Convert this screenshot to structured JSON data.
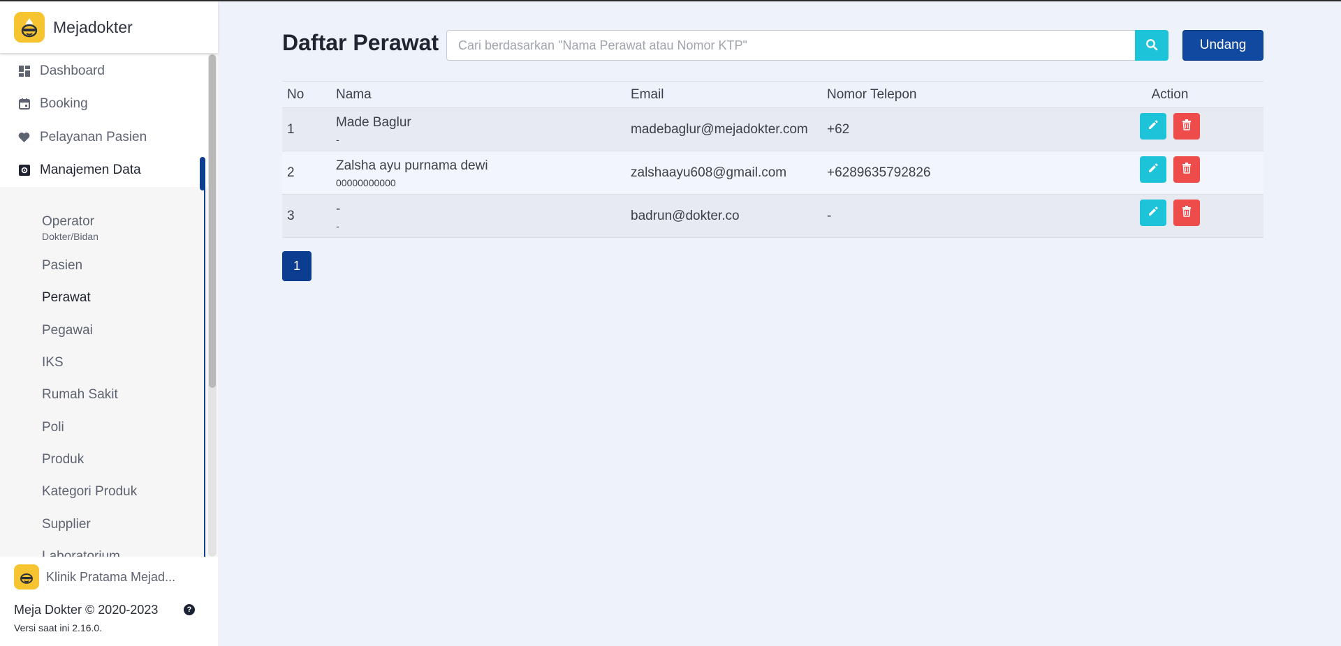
{
  "brand": {
    "name": "Mejadokter"
  },
  "nav": {
    "items": [
      {
        "label": "Dashboard",
        "icon": "dashboard-icon"
      },
      {
        "label": "Booking",
        "icon": "calendar-icon"
      },
      {
        "label": "Pelayanan Pasien",
        "icon": "heart-icon"
      },
      {
        "label": "Manajemen Data",
        "icon": "gear-icon",
        "active": true
      }
    ],
    "sub_items": [
      {
        "label": "Operator",
        "sub": "Dokter/Bidan"
      },
      {
        "label": "Pasien"
      },
      {
        "label": "Perawat",
        "active": true
      },
      {
        "label": "Pegawai"
      },
      {
        "label": "IKS"
      },
      {
        "label": "Rumah Sakit"
      },
      {
        "label": "Poli"
      },
      {
        "label": "Produk"
      },
      {
        "label": "Kategori Produk"
      },
      {
        "label": "Supplier"
      },
      {
        "label": "Laboratorium"
      }
    ]
  },
  "footer": {
    "clinic_name": "Klinik Pratama Mejad...",
    "copyright": "Meja Dokter © 2020-2023",
    "version": "Versi saat ini 2.16.0."
  },
  "page": {
    "title": "Daftar Perawat",
    "search_placeholder": "Cari berdasarkan \"Nama Perawat atau Nomor KTP\"",
    "invite_label": "Undang"
  },
  "table": {
    "headers": {
      "no": "No",
      "name": "Nama",
      "email": "Email",
      "phone": "Nomor Telepon",
      "action": "Action"
    },
    "rows": [
      {
        "no": "1",
        "name": "Made Baglur",
        "sub": "-",
        "email": "madebaglur@mejadokter.com",
        "phone": "+62"
      },
      {
        "no": "2",
        "name": "Zalsha ayu purnama dewi",
        "sub": "00000000000",
        "email": "zalshaayu608@gmail.com",
        "phone": "+6289635792826"
      },
      {
        "no": "3",
        "name": "-",
        "sub": "-",
        "email": "badrun@dokter.co",
        "phone": "-"
      }
    ]
  },
  "pagination": {
    "current": "1"
  },
  "colors": {
    "primary": "#0b3d91",
    "accent": "#1cc3d9",
    "danger": "#ee4b4b",
    "brand_yellow": "#f6c431"
  }
}
